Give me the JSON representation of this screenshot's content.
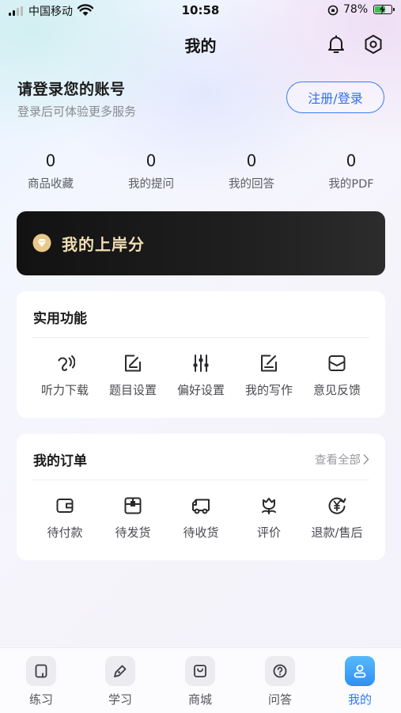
{
  "status_bar": {
    "carrier": "中国移动",
    "time": "10:58",
    "battery_percent": "78%",
    "battery_level": 0.78,
    "battery_color": "#3bc24a"
  },
  "header": {
    "title": "我的",
    "icons": [
      "bell-icon",
      "settings-icon"
    ]
  },
  "login": {
    "title": "请登录您的账号",
    "subtitle": "登录后可体验更多服务",
    "button_label": "注册/登录",
    "accent": "#2f6fe8"
  },
  "stats": [
    {
      "value": "0",
      "label": "商品收藏"
    },
    {
      "value": "0",
      "label": "我的提问"
    },
    {
      "value": "0",
      "label": "我的回答"
    },
    {
      "value": "0",
      "label": "我的PDF"
    }
  ],
  "score_banner": {
    "label": "我的上岸分",
    "icon": "diamond-badge-icon",
    "text_color": "#f2dfb4"
  },
  "tools": {
    "title": "实用功能",
    "items": [
      {
        "label": "听力下载",
        "icon": "ear-icon"
      },
      {
        "label": "题目设置",
        "icon": "edit-frame-icon"
      },
      {
        "label": "偏好设置",
        "icon": "sliders-icon"
      },
      {
        "label": "我的写作",
        "icon": "writing-icon"
      },
      {
        "label": "意见反馈",
        "icon": "mail-icon"
      }
    ]
  },
  "orders": {
    "title": "我的订单",
    "view_all": "查看全部",
    "items": [
      {
        "label": "待付款",
        "icon": "wallet-icon"
      },
      {
        "label": "待发货",
        "icon": "package-icon"
      },
      {
        "label": "待收货",
        "icon": "truck-icon"
      },
      {
        "label": "评价",
        "icon": "flower-icon"
      },
      {
        "label": "退款/售后",
        "icon": "yen-refund-icon"
      }
    ]
  },
  "tabbar": {
    "active_color": "#2f78ee",
    "items": [
      {
        "label": "练习",
        "icon": "practice-icon",
        "active": false
      },
      {
        "label": "学习",
        "icon": "pen-icon",
        "active": false
      },
      {
        "label": "商城",
        "icon": "shopping-bag-icon",
        "active": false
      },
      {
        "label": "问答",
        "icon": "question-icon",
        "active": false
      },
      {
        "label": "我的",
        "icon": "user-icon",
        "active": true
      }
    ]
  }
}
